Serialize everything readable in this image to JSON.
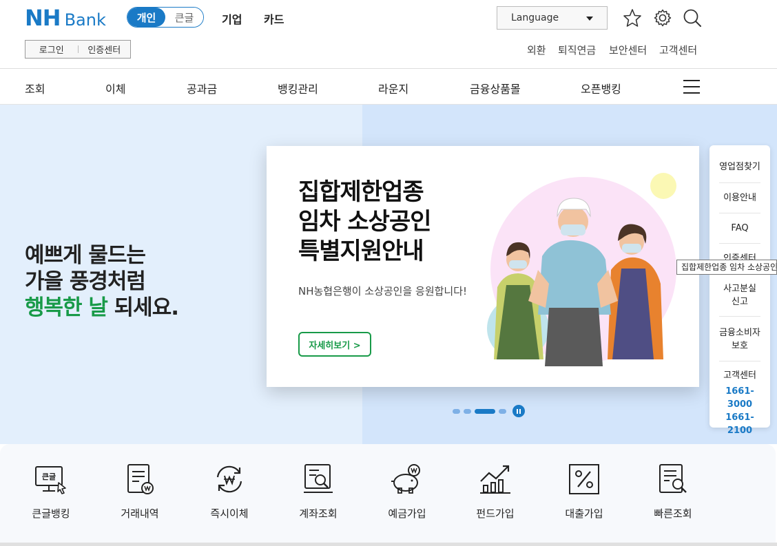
{
  "brand": {
    "logo_nh": "NH",
    "logo_bank": "Bank",
    "color": "#1a7ac6",
    "accent_green": "#189a48"
  },
  "header": {
    "segment": {
      "active": "개인",
      "inactive": "큰글"
    },
    "links": {
      "corporate": "기업",
      "card": "카드"
    },
    "language": "Language",
    "icons": [
      "star-icon",
      "settings-icon",
      "search-icon"
    ],
    "login_box": {
      "login": "로그인",
      "cert": "인증센터"
    },
    "util_links": [
      "외환",
      "퇴직연금",
      "보안센터",
      "고객센터"
    ]
  },
  "nav": {
    "items": [
      "조회",
      "이체",
      "공과금",
      "뱅킹관리",
      "라운지",
      "금융상품몰",
      "오픈뱅킹"
    ],
    "menu_icon": "hamburger-icon"
  },
  "hero": {
    "line1": "예쁘게 물드는",
    "line2": "가을 풍경처럼",
    "line3_green": "행복한 날",
    "line3_rest": " 되세요."
  },
  "banner": {
    "title1": "집합제한업종",
    "title2": "임차 소상공인",
    "title3": "특별지원안내",
    "subtitle": "NH농협은행이 소상공인을 응원합니다!",
    "button": "자세히보기  >",
    "slides": 4,
    "active_slide": 3
  },
  "side_menu": {
    "branch": "영업점찾기",
    "guide": "이용안내",
    "faq": "FAQ",
    "cert": "인증센터",
    "lost1": "사고분실",
    "lost2": "신고",
    "protect1": "금융소비자",
    "protect2": "보호",
    "cs": "고객센터",
    "phone1": "1661-3000",
    "phone2": "1661-2100",
    "tooltip": "집합제한업종 임차 소상공인"
  },
  "quick": {
    "items": [
      "큰글뱅킹",
      "거래내역",
      "즉시이체",
      "계좌조회",
      "예금가입",
      "펀드가입",
      "대출가입",
      "빠른조회"
    ],
    "bigtext_icon_label": "큰글"
  }
}
